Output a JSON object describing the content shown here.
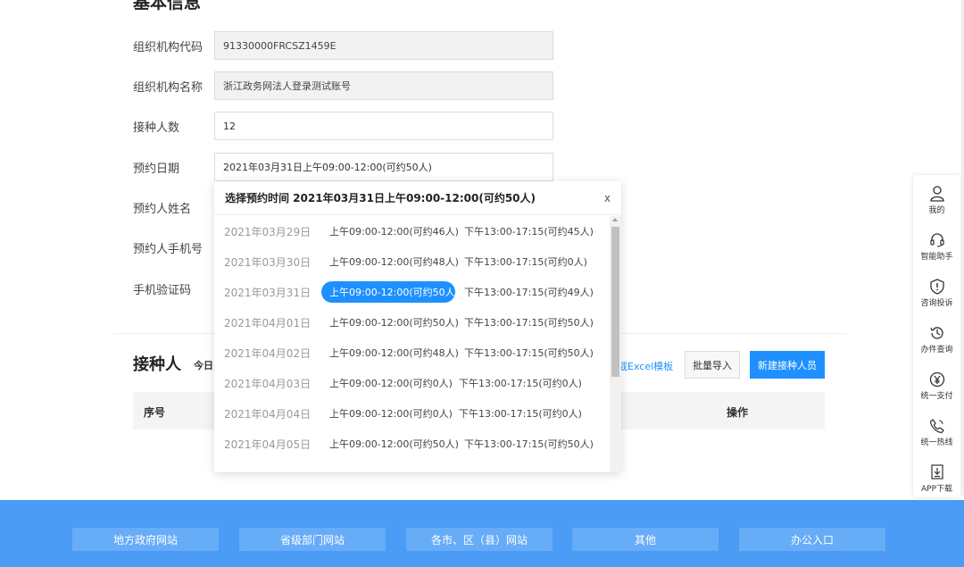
{
  "section": {
    "title": "基本信息"
  },
  "form": {
    "org_code": {
      "label": "组织机构代码",
      "value": "91330000FRCSZ1459E"
    },
    "org_name": {
      "label": "组织机构名称",
      "value": "浙江政务网法人登录测试账号"
    },
    "count": {
      "label": "接种人数",
      "value": "12"
    },
    "date": {
      "label": "预约日期",
      "value": "2021年03月31日上午09:00-12:00(可约50人)"
    },
    "name": {
      "label": "预约人姓名"
    },
    "phone": {
      "label": "预约人手机号"
    },
    "code": {
      "label": "手机验证码"
    }
  },
  "dropdown": {
    "title": "选择预约时间 2021年03月31日上午09:00-12:00(可约50人)",
    "close": "x",
    "rows": [
      {
        "date": "2021年03月29日",
        "am": "上午09:00-12:00(可约46人)",
        "pm": "下午13:00-17:15(可约45人)"
      },
      {
        "date": "2021年03月30日",
        "am": "上午09:00-12:00(可约48人)",
        "pm": "下午13:00-17:15(可约0人)"
      },
      {
        "date": "2021年03月31日",
        "am": "上午09:00-12:00(可约50人)",
        "pm": "下午13:00-17:15(可约49人)"
      },
      {
        "date": "2021年04月01日",
        "am": "上午09:00-12:00(可约50人)",
        "pm": "下午13:00-17:15(可约50人)"
      },
      {
        "date": "2021年04月02日",
        "am": "上午09:00-12:00(可约48人)",
        "pm": "下午13:00-17:15(可约50人)"
      },
      {
        "date": "2021年04月03日",
        "am": "上午09:00-12:00(可约0人)",
        "pm": "下午13:00-17:15(可约0人)"
      },
      {
        "date": "2021年04月04日",
        "am": "上午09:00-12:00(可约0人)",
        "pm": "下午13:00-17:15(可约0人)"
      },
      {
        "date": "2021年04月05日",
        "am": "上午09:00-12:00(可约50人)",
        "pm": "下午13:00-17:15(可约50人)"
      }
    ]
  },
  "recipients": {
    "title": "接种人",
    "subtitle": "今日",
    "excel_link": "载Excel模板",
    "import_button": "批量导入",
    "new_button": "新建接种人员",
    "columns": [
      "序号",
      "操作"
    ]
  },
  "float_bar": {
    "items": [
      {
        "label": "我的",
        "icon": "user-icon"
      },
      {
        "label": "智能助手",
        "icon": "headset-icon"
      },
      {
        "label": "咨询投诉",
        "icon": "shield-alert-icon"
      },
      {
        "label": "办件查询",
        "icon": "history-icon"
      },
      {
        "label": "统一支付",
        "icon": "yuan-icon"
      },
      {
        "label": "统一热线",
        "icon": "phone-icon"
      },
      {
        "label": "APP下载",
        "icon": "download-icon"
      }
    ]
  },
  "footer": {
    "links": [
      "地方政府网站",
      "省级部门网站",
      "各市、区（县）网站",
      "其他",
      "办公入口"
    ]
  },
  "colors": {
    "accent": "#1e90ff",
    "footer_bg": "#4a9cf5",
    "footer_btn": "#66acf7"
  }
}
